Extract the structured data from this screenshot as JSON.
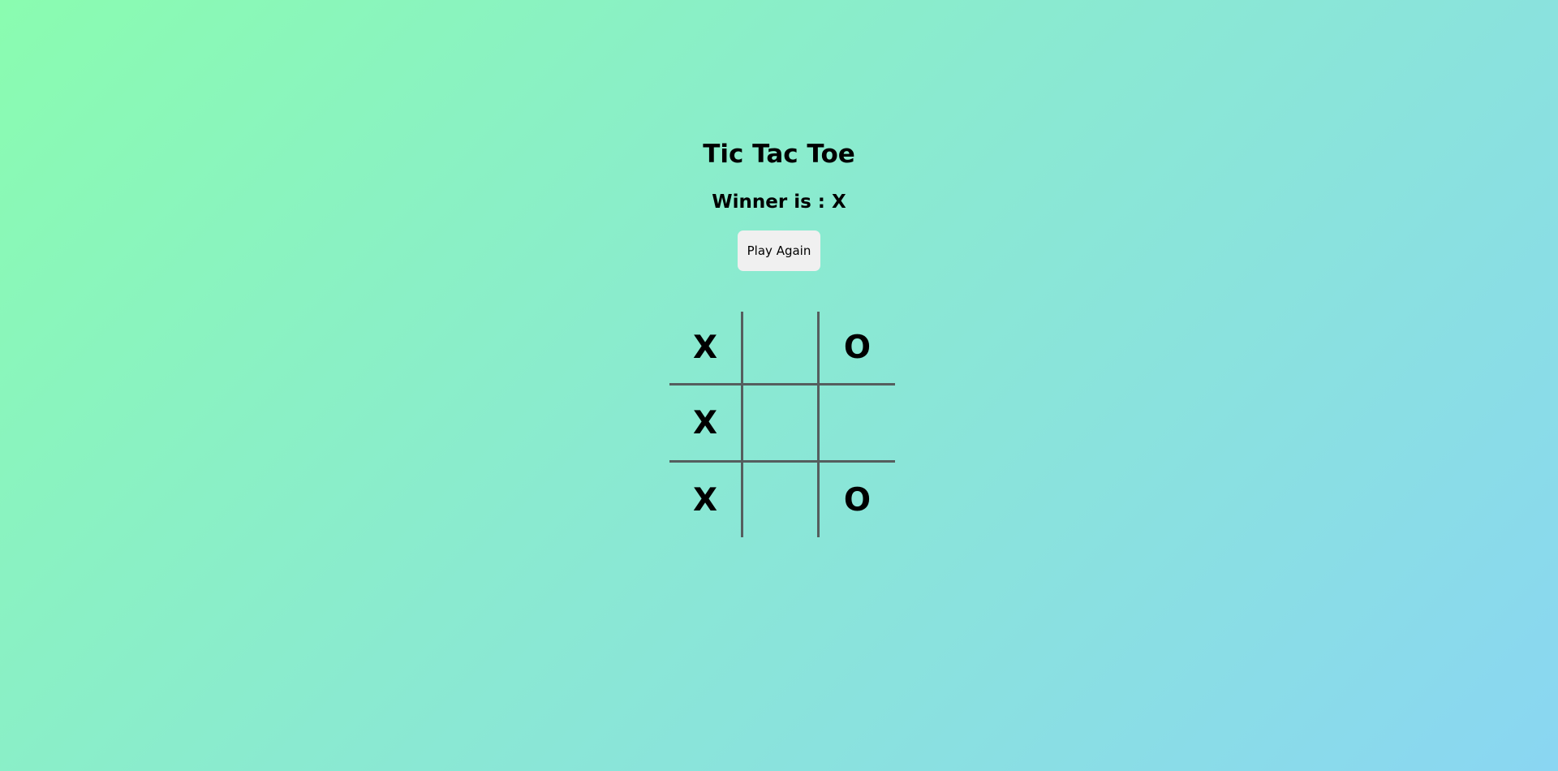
{
  "title": "Tic Tac Toe",
  "status": "Winner is : X",
  "play_again_label": "Play Again",
  "board": {
    "cells": [
      "X",
      "",
      "O",
      "X",
      "",
      "",
      "X",
      "",
      "O"
    ]
  },
  "colors": {
    "background_start": "#8afcb0",
    "background_end": "#8ad6f2",
    "grid_line": "#555e5e",
    "button_bg": "#f0f0f0"
  }
}
